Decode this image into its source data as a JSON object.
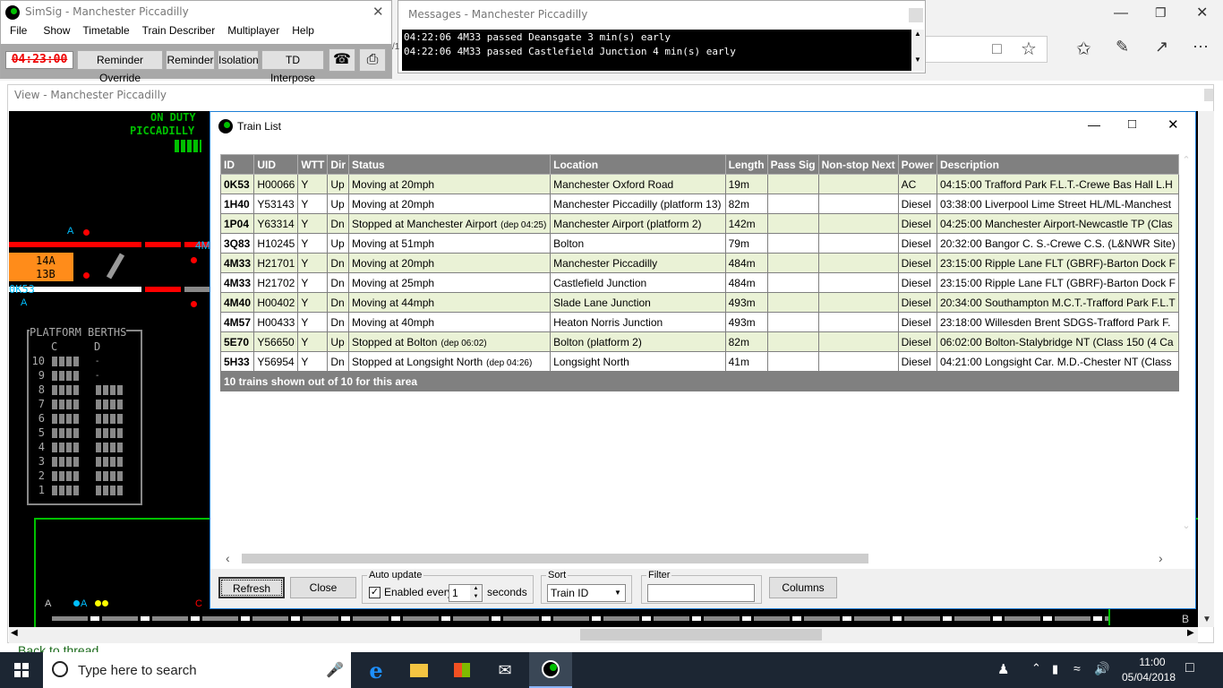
{
  "simsig": {
    "title": "SimSig - Manchester Piccadilly",
    "menu": [
      "File",
      "Show",
      "Timetable",
      "Train Describer",
      "Multiplayer",
      "Help"
    ],
    "clock": "04:23:00",
    "buttons": [
      "Reminder Override",
      "Reminder",
      "Isolation",
      "TD Interpose"
    ]
  },
  "messages": {
    "title": "Messages - Manchester Piccadilly",
    "lines": [
      "04:22:06 4M33 passed Deansgate 3 min(s) early",
      "04:22:06 4M33 passed Castlefield Junction 4 min(s) early"
    ],
    "peek": "/1"
  },
  "view": {
    "title": "View - Manchester Piccadilly",
    "on_duty": "ON DUTY",
    "area": "PICCADILLY",
    "platform_berths": "PLATFORM BERTHS",
    "col_c": "C",
    "col_d": "D",
    "platform_numbers": [
      "10",
      "9",
      "8",
      "7",
      "6",
      "5",
      "4",
      "3",
      "2",
      "1"
    ],
    "berth_14a": "14A",
    "berth_13b": "13B",
    "berth_0k53": "0K53",
    "label_a1": "A",
    "label_a2": "A",
    "label_4m": "4M",
    "label_a3": "A",
    "label_a4": "A",
    "label_b": "B",
    "label_c": "C"
  },
  "train_list": {
    "title": "Train List",
    "columns": [
      "ID",
      "UID",
      "WTT",
      "Dir",
      "Status",
      "Location",
      "Length",
      "Pass Sig",
      "Non-stop Next",
      "Power",
      "Description"
    ],
    "rows": [
      {
        "id": "0K53",
        "uid": "H00066",
        "wtt": "Y",
        "dir": "Up",
        "status": "Moving at 20mph",
        "status_note": "",
        "location": "Manchester Oxford Road",
        "length": "19m",
        "pass_sig": "",
        "nonstop": "",
        "power": "AC",
        "desc": "04:15:00 Trafford Park F.L.T.-Crewe Bas Hall L.H"
      },
      {
        "id": "1H40",
        "uid": "Y53143",
        "wtt": "Y",
        "dir": "Up",
        "status": "Moving at 20mph",
        "status_note": "",
        "location": "Manchester Piccadilly (platform 13)",
        "length": "82m",
        "pass_sig": "",
        "nonstop": "",
        "power": "Diesel",
        "desc": "03:38:00 Liverpool Lime Street HL/ML-Manchest"
      },
      {
        "id": "1P04",
        "uid": "Y63314",
        "wtt": "Y",
        "dir": "Dn",
        "status": "Stopped at Manchester Airport",
        "status_note": "(dep 04:25)",
        "location": "Manchester Airport (platform 2)",
        "length": "142m",
        "pass_sig": "",
        "nonstop": "",
        "power": "Diesel",
        "desc": "04:25:00 Manchester Airport-Newcastle TP (Clas"
      },
      {
        "id": "3Q83",
        "uid": "H10245",
        "wtt": "Y",
        "dir": "Up",
        "status": "Moving at 51mph",
        "status_note": "",
        "location": "Bolton",
        "length": "79m",
        "pass_sig": "",
        "nonstop": "",
        "power": "Diesel",
        "desc": "20:32:00 Bangor C. S.-Crewe C.S. (L&NWR Site)"
      },
      {
        "id": "4M33",
        "uid": "H21701",
        "wtt": "Y",
        "dir": "Dn",
        "status": "Moving at 20mph",
        "status_note": "",
        "location": "Manchester Piccadilly",
        "length": "484m",
        "pass_sig": "",
        "nonstop": "",
        "power": "Diesel",
        "desc": "23:15:00 Ripple Lane FLT (GBRF)-Barton Dock F"
      },
      {
        "id": "4M33",
        "uid": "H21702",
        "wtt": "Y",
        "dir": "Dn",
        "status": "Moving at 25mph",
        "status_note": "",
        "location": "Castlefield Junction",
        "length": "484m",
        "pass_sig": "",
        "nonstop": "",
        "power": "Diesel",
        "desc": "23:15:00 Ripple Lane FLT (GBRF)-Barton Dock F"
      },
      {
        "id": "4M40",
        "uid": "H00402",
        "wtt": "Y",
        "dir": "Dn",
        "status": "Moving at 44mph",
        "status_note": "",
        "location": "Slade Lane Junction",
        "length": "493m",
        "pass_sig": "",
        "nonstop": "",
        "power": "Diesel",
        "desc": "20:34:00 Southampton M.C.T.-Trafford Park F.L.T"
      },
      {
        "id": "4M57",
        "uid": "H00433",
        "wtt": "Y",
        "dir": "Dn",
        "status": "Moving at 40mph",
        "status_note": "",
        "location": "Heaton Norris Junction",
        "length": "493m",
        "pass_sig": "",
        "nonstop": "",
        "power": "Diesel",
        "desc": "23:18:00 Willesden Brent SDGS-Trafford Park F."
      },
      {
        "id": "5E70",
        "uid": "Y56650",
        "wtt": "Y",
        "dir": "Up",
        "status": "Stopped at Bolton",
        "status_note": "(dep 06:02)",
        "location": "Bolton (platform 2)",
        "length": "82m",
        "pass_sig": "",
        "nonstop": "",
        "power": "Diesel",
        "desc": "06:02:00 Bolton-Stalybridge NT (Class 150 (4 Ca"
      },
      {
        "id": "5H33",
        "uid": "Y56954",
        "wtt": "Y",
        "dir": "Dn",
        "status": "Stopped at Longsight North",
        "status_note": "(dep 04:26)",
        "location": "Longsight North",
        "length": "41m",
        "pass_sig": "",
        "nonstop": "",
        "power": "Diesel",
        "desc": "04:21:00 Longsight Car. M.D.-Chester NT (Class"
      }
    ],
    "footer": "10 trains shown out of 10 for this area",
    "refresh": "Refresh",
    "close": "Close",
    "auto_update_legend": "Auto update",
    "enabled_every": "Enabled every",
    "interval": "1",
    "seconds": "seconds",
    "sort_legend": "Sort",
    "sort_value": "Train ID",
    "filter_legend": "Filter",
    "filter_value": "",
    "columns_button": "Columns"
  },
  "taskbar": {
    "search_placeholder": "Type here to search",
    "time": "11:00",
    "date": "05/04/2018"
  },
  "browser": {
    "back_link": "Back to thread"
  },
  "colors": {
    "track_red": "#ff0000",
    "track_white": "#ffffff",
    "berth_orange": "#ff8c1a",
    "green_text": "#00c000",
    "cyan": "#00bfff",
    "row_alt": "#eaf2d6",
    "header_gray": "#808080"
  }
}
